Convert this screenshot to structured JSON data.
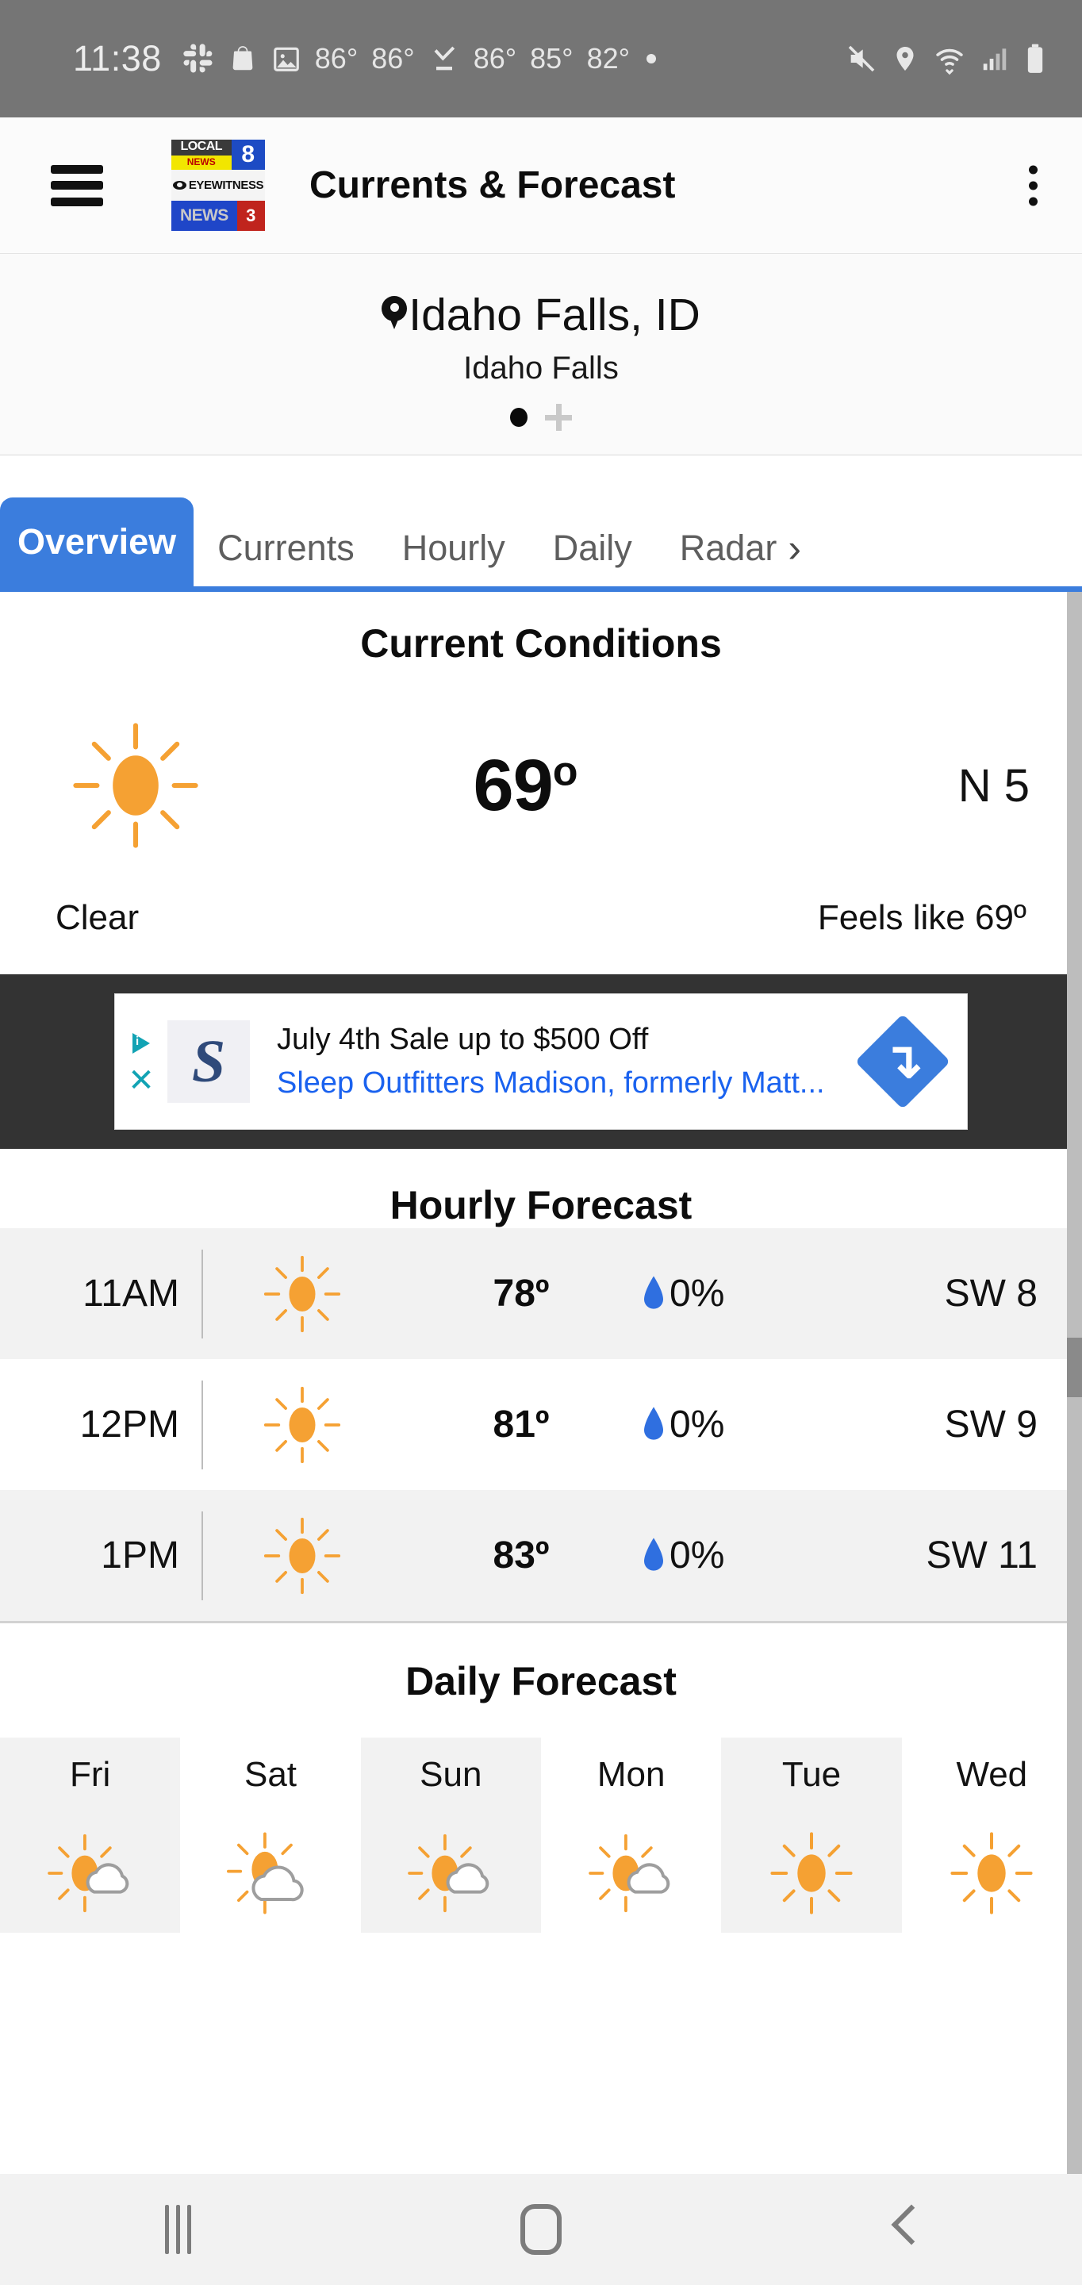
{
  "statusbar": {
    "time": "11:38",
    "icons": [
      "slack-icon",
      "shopping-bag-icon",
      "image-icon"
    ],
    "temps": [
      "86°",
      "86°",
      "86°",
      "85°",
      "82°"
    ],
    "download_icon": "download-complete-icon",
    "dot": "•",
    "right_icons": [
      "mute-icon",
      "location-icon",
      "wifi-icon",
      "signal-icon",
      "battery-icon"
    ]
  },
  "appbar": {
    "menu_icon": "hamburger-menu-icon",
    "logo": {
      "line1_left": "LOCAL",
      "line1_news": "NEWS",
      "line1_right": "8",
      "line2": "EYEWITNESS",
      "line3_left": "NEWS",
      "line3_right": "3"
    },
    "title": "Currents & Forecast",
    "overflow_icon": "more-options-icon"
  },
  "location": {
    "pin_icon": "location-pin-icon",
    "city": "Idaho Falls, ID",
    "subtitle": "Idaho Falls",
    "add_label": "+"
  },
  "tabs": [
    {
      "label": "Overview",
      "active": true
    },
    {
      "label": "Currents",
      "active": false
    },
    {
      "label": "Hourly",
      "active": false
    },
    {
      "label": "Daily",
      "active": false
    },
    {
      "label": "Radar",
      "active": false
    }
  ],
  "tab_arrow": "›",
  "current_conditions": {
    "title": "Current Conditions",
    "icon": "sun-icon",
    "temperature": "69",
    "degree": "o",
    "wind": "N  5",
    "condition": "Clear",
    "feels_like": "Feels like 69º"
  },
  "ad": {
    "adchoices_icon": "adchoices-icon",
    "close_icon": "close-icon",
    "logo_letter": "S",
    "headline": "July 4th Sale up to $500 Off",
    "subline": "Sleep Outfitters Madison, formerly Matt...",
    "cta_icon": "arrow-forward-icon"
  },
  "hourly": {
    "title": "Hourly Forecast",
    "rows": [
      {
        "time": "11AM",
        "icon": "sun-icon",
        "temp": "78º",
        "pop": "0%",
        "wind": "SW  8"
      },
      {
        "time": "12PM",
        "icon": "sun-icon",
        "temp": "81º",
        "pop": "0%",
        "wind": "SW  9"
      },
      {
        "time": "1PM",
        "icon": "sun-icon",
        "temp": "83º",
        "pop": "0%",
        "wind": "SW 11"
      }
    ]
  },
  "daily": {
    "title": "Daily Forecast",
    "days": [
      {
        "name": "Fri",
        "icon": "sun-cloud-icon"
      },
      {
        "name": "Sat",
        "icon": "cloud-sun-icon"
      },
      {
        "name": "Sun",
        "icon": "sun-cloud-icon"
      },
      {
        "name": "Mon",
        "icon": "sun-cloud-icon"
      },
      {
        "name": "Tue",
        "icon": "sun-icon"
      },
      {
        "name": "Wed",
        "icon": "sun-icon"
      }
    ]
  },
  "navbar": {
    "recents": "recents-icon",
    "home": "home-icon",
    "back": "back-icon"
  },
  "colors": {
    "accent_blue": "#3b7ddd",
    "sun_orange": "#f5a133",
    "droplet_blue": "#2f6fe0",
    "statusbar_gray": "#757575",
    "ad_background": "#333333"
  }
}
